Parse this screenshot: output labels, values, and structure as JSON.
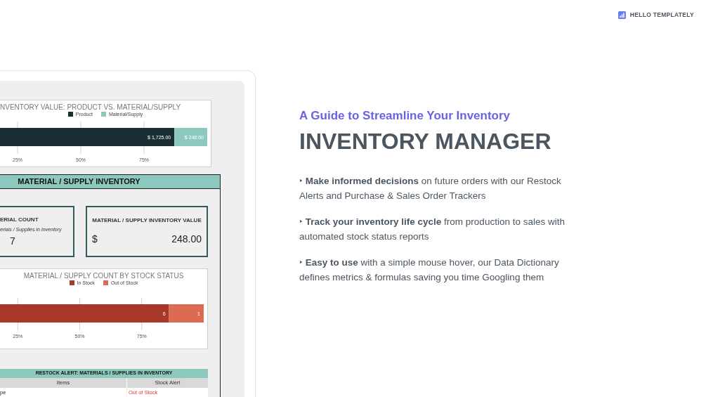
{
  "brand": {
    "name": "HELLO TEMPLATELY"
  },
  "dashboard": {
    "value_chart": {
      "title": "NVENTORY VALUE: PRODUCT VS. MATERIAL/SUPPLY",
      "chart_data": {
        "type": "bar",
        "orientation": "horizontal",
        "stacked": true,
        "xlim": [
          0,
          1
        ],
        "series": [
          {
            "name": "Product",
            "color": "#1b2e33",
            "values": [
              0.87
            ]
          },
          {
            "name": "Material/Supply",
            "color": "#8cc8bd",
            "values": [
              0.13
            ]
          }
        ],
        "grid": true,
        "value_labels": [
          "$ 1,725.00",
          "$ 248.00"
        ],
        "xticks": [
          {
            "value": 0.25,
            "label": "25%"
          },
          {
            "value": 0.5,
            "label": "50%"
          },
          {
            "value": 0.75,
            "label": "75%"
          }
        ]
      }
    },
    "section_title": "MATERIAL / SUPPLY INVENTORY",
    "count_card": {
      "title": "ERIAL COUNT",
      "caption": "erials / Supplies in Inventory",
      "value": "7"
    },
    "value_card": {
      "title": "MATERIAL / SUPPLY INVENTORY VALUE",
      "currency": "$",
      "value": "248.00"
    },
    "status_chart": {
      "title": "MATERIAL / SUPPLY COUNT BY STOCK STATUS",
      "chart_data": {
        "type": "bar",
        "orientation": "horizontal",
        "stacked": true,
        "xlim": [
          0,
          1
        ],
        "series": [
          {
            "name": "In Stock",
            "color": "#a8382a",
            "values": [
              0.86
            ]
          },
          {
            "name": "Out of Stock",
            "color": "#dd6b52",
            "values": [
              0.14
            ]
          }
        ],
        "grid": true,
        "value_labels": [
          "6",
          "1"
        ],
        "xticks": [
          {
            "value": 0.25,
            "label": "25%"
          },
          {
            "value": 0.5,
            "label": "50%"
          },
          {
            "value": 0.75,
            "label": "75%"
          }
        ]
      }
    },
    "restock_table": {
      "title": "RESTOCK ALERT: MATERIALS / SUPPLIES IN INVENTORY",
      "columns": [
        "Items",
        "Stock Alert"
      ],
      "rows": [
        [
          "pe",
          "Out of Stock"
        ]
      ]
    }
  },
  "hero": {
    "subtitle": "A Guide to Streamline Your Inventory",
    "title": "INVENTORY MANAGER",
    "bullets": [
      "‣ **Make informed decisions** on future orders with our Restock Alerts and Purchase & Sales Order Trackers",
      "‣ **Track your inventory life cycle** from production to sales with automated stock status reports",
      "‣ **Easy to use** with a simple mouse hover, our Data Dictionary defines metrics & formulas saving you time Googling them"
    ]
  }
}
